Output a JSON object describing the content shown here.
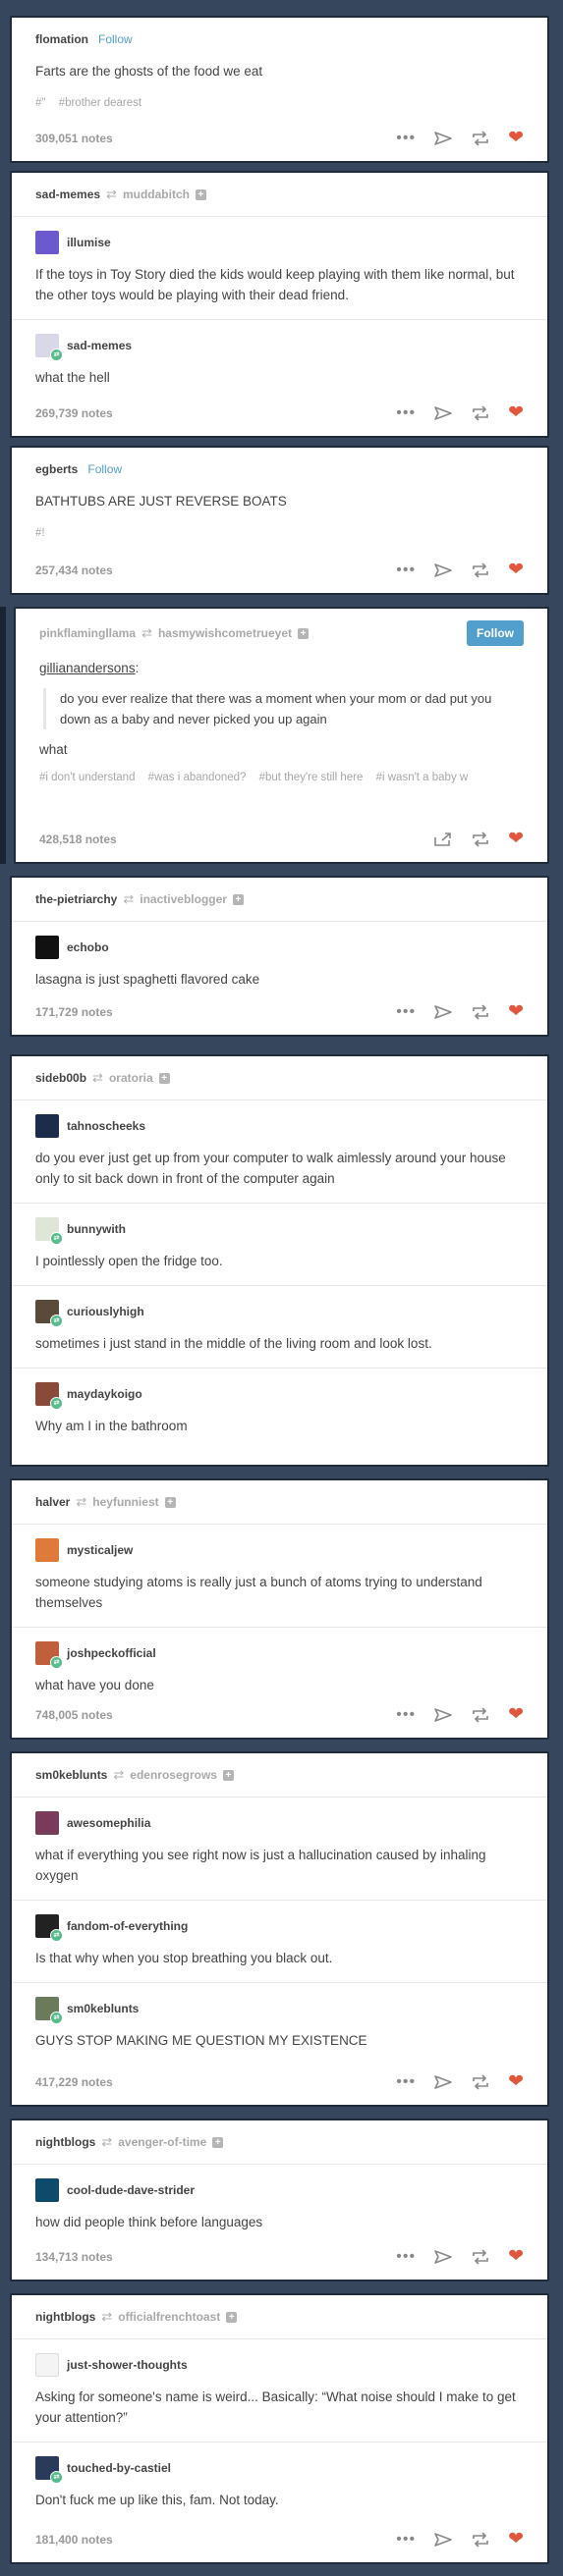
{
  "posts": [
    {
      "blog": "flomation",
      "follow": "Follow",
      "text": "Farts are the ghosts of the food we eat",
      "tags": [
        "#\"",
        "#brother dearest"
      ],
      "notes": "309,051 notes"
    },
    {
      "blog": "sad-memes",
      "reblogged_from": "muddabitch",
      "thread": [
        {
          "user": "illumise",
          "text": "If the toys in Toy Story died the kids would keep playing with them like normal, but the other toys would be playing with their dead friend."
        },
        {
          "user": "sad-memes",
          "text": "what the hell"
        }
      ],
      "notes": "269,739 notes"
    },
    {
      "blog": "egberts",
      "follow": "Follow",
      "text": "BATHTUBS ARE JUST REVERSE BOATS",
      "tags": [
        "#!"
      ],
      "notes": "257,434 notes"
    },
    {
      "blog": "pinkflamingllama",
      "reblogged_from": "hasmywishcometrueyet",
      "follow_button": "Follow",
      "quote_source": "gillianandersons",
      "quote": "do you ever realize that there was a moment when your mom or dad put you down as a baby and never picked you up again",
      "text": "what",
      "tags": [
        "#i don't understand",
        "#was i abandoned?",
        "#but they're still here",
        "#i wasn't a baby w"
      ],
      "notes": "428,518 notes"
    },
    {
      "blog": "the-pietriarchy",
      "reblogged_from": "inactiveblogger",
      "thread": [
        {
          "user": "echobo",
          "text": "lasagna is just spaghetti flavored cake"
        }
      ],
      "notes": "171,729 notes"
    },
    {
      "blog": "sideb00b",
      "reblogged_from": "oratoria",
      "thread": [
        {
          "user": "tahnoscheeks",
          "text": "do you ever just get up from your computer to walk aimlessly around your house only to sit back down in front of the computer again"
        },
        {
          "user": "bunnywith",
          "text": "I pointlessly open the fridge too."
        },
        {
          "user": "curiouslyhigh",
          "text": "sometimes i just stand in the middle of the living room and look lost."
        },
        {
          "user": "maydaykoigo",
          "text": "Why am I in the bathroom"
        }
      ]
    },
    {
      "blog": "halver",
      "reblogged_from": "heyfunniest",
      "thread": [
        {
          "user": "mysticaljew",
          "text": "someone studying atoms is really just a bunch of atoms trying to understand themselves"
        },
        {
          "user": "joshpeckofficial",
          "text": "what have you done"
        }
      ],
      "notes": "748,005 notes"
    },
    {
      "blog": "sm0keblunts",
      "reblogged_from": "edenrosegrows",
      "thread": [
        {
          "user": "awesomephilia",
          "text": "what if everything you see right now is just a hallucination caused by inhaling oxygen"
        },
        {
          "user": "fandom-of-everything",
          "text": "Is that why when you stop breathing you black out."
        },
        {
          "user": "sm0keblunts",
          "text": "GUYS STOP MAKING ME QUESTION MY EXISTENCE"
        }
      ],
      "notes": "417,229 notes"
    },
    {
      "blog": "nightblogs",
      "reblogged_from": "avenger-of-time",
      "thread": [
        {
          "user": "cool-dude-dave-strider",
          "text": "how did people think before languages"
        }
      ],
      "notes": "134,713 notes"
    },
    {
      "blog": "nightblogs",
      "reblogged_from": "officialfrenchtoast",
      "thread": [
        {
          "user": "just-shower-thoughts",
          "text": "Asking for someone's name is weird... Basically: “What noise should I make to get your attention?”"
        },
        {
          "user": "touched-by-castiel",
          "text": "Don't fuck me up like this, fam. Not today."
        }
      ],
      "notes": "181,400 notes"
    }
  ],
  "icons": {
    "more": "more-dots-icon",
    "share": "share-icon",
    "reblog": "reblog-icon",
    "like": "heart-icon"
  },
  "colors": {
    "background": "#36465d",
    "follow": "#529ecc",
    "heart": "#e0573d",
    "badge": "#56bc8a"
  }
}
